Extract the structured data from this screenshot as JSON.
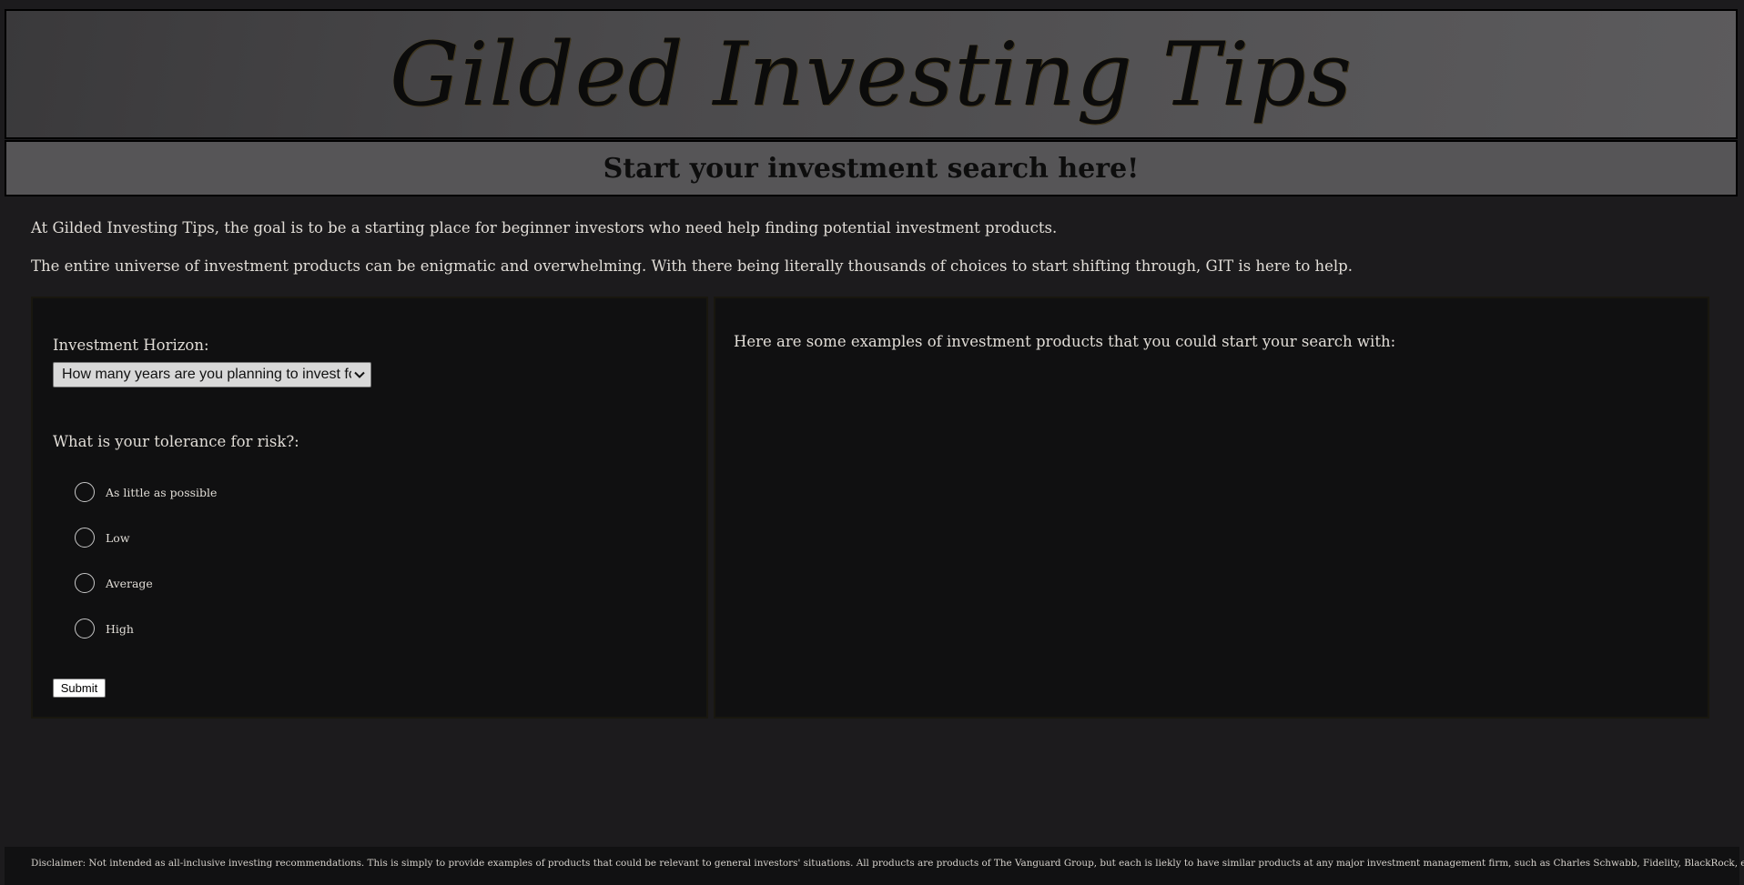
{
  "header": {
    "title": "Gilded Investing Tips",
    "subtitle": "Start your investment search here!"
  },
  "intro": {
    "line1": "At Gilded Investing Tips, the goal is to be a starting place for beginner investors who need help finding potential investment products.",
    "line2": "The entire universe of investment products can be enigmatic and overwhelming. With there being literally thousands of choices to start shifting through, GIT is here to help."
  },
  "form": {
    "horizon_label": "Investment Horizon:",
    "horizon_select_value": "How many years are you planning to invest for?",
    "risk_label": "What is your tolerance for risk?:",
    "risk_options": [
      {
        "label": "As little as possible",
        "checked": false
      },
      {
        "label": "Low",
        "checked": false
      },
      {
        "label": "Average",
        "checked": false
      },
      {
        "label": "High",
        "checked": false
      }
    ],
    "submit_label": "Submit"
  },
  "results": {
    "heading": "Here are some examples of investment products that you could start your search with:"
  },
  "footer": {
    "disclaimer": "Disclaimer: Not intended as all-inclusive investing recommendations. This is simply to provide examples of products that could be relevant to general investors' situations. All products are products of The Vanguard Group, but each is liekly to have similar products at any major investment management firm, such as Charles Schwabb, Fidelity, BlackRock, etc."
  },
  "colors": {
    "page_background": "#1c1b1d",
    "panel_background": "#101011",
    "banner_background": "#565557",
    "text": "#e0dcd6"
  }
}
